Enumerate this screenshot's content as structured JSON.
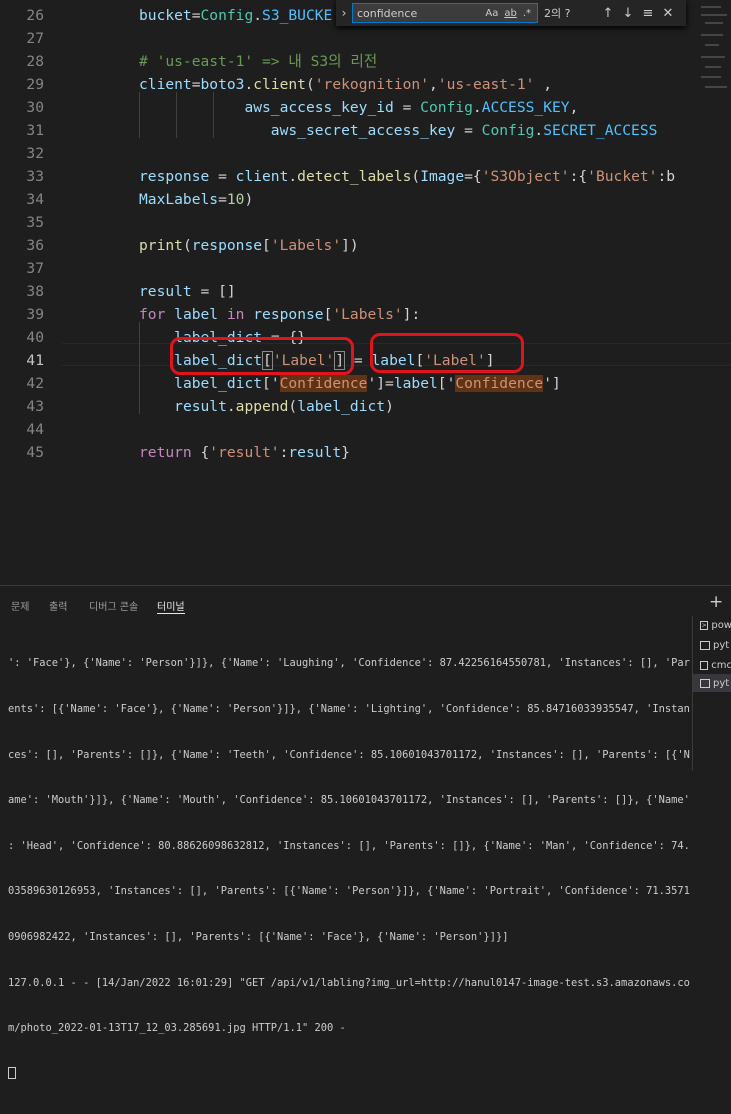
{
  "editor": {
    "lines": [
      {
        "num": "26",
        "tokens": [
          {
            "t": "bucket",
            "c": "v"
          },
          {
            "t": "=",
            "c": "p"
          },
          {
            "t": "Config",
            "c": "cl"
          },
          {
            "t": ".",
            "c": "p"
          },
          {
            "t": "S3_BUCKE",
            "c": "cst"
          }
        ]
      },
      {
        "num": "27",
        "tokens": []
      },
      {
        "num": "28",
        "tokens": [
          {
            "t": "# 'us-east-1' => 내 S3의 리전",
            "c": "c"
          }
        ]
      },
      {
        "num": "29",
        "tokens": [
          {
            "t": "client",
            "c": "v"
          },
          {
            "t": "=",
            "c": "p"
          },
          {
            "t": "boto3",
            "c": "v"
          },
          {
            "t": ".",
            "c": "p"
          },
          {
            "t": "client",
            "c": "f"
          },
          {
            "t": "(",
            "c": "p"
          },
          {
            "t": "'rekognition'",
            "c": "s"
          },
          {
            "t": ",",
            "c": "p"
          },
          {
            "t": "'us-east-1'",
            "c": "s"
          },
          {
            "t": " ,",
            "c": "p"
          }
        ]
      },
      {
        "num": "30",
        "tokens": [
          {
            "t": "            ",
            "c": "p"
          },
          {
            "t": "aws_access_key_id",
            "c": "v"
          },
          {
            "t": " = ",
            "c": "p"
          },
          {
            "t": "Config",
            "c": "cl"
          },
          {
            "t": ".",
            "c": "p"
          },
          {
            "t": "ACCESS_KEY",
            "c": "cst"
          },
          {
            "t": ",",
            "c": "p"
          }
        ]
      },
      {
        "num": "31",
        "tokens": [
          {
            "t": "               ",
            "c": "p"
          },
          {
            "t": "aws_secret_access_key",
            "c": "v"
          },
          {
            "t": " = ",
            "c": "p"
          },
          {
            "t": "Config",
            "c": "cl"
          },
          {
            "t": ".",
            "c": "p"
          },
          {
            "t": "SECRET_ACCESS",
            "c": "cst"
          }
        ]
      },
      {
        "num": "32",
        "tokens": []
      },
      {
        "num": "33",
        "tokens": [
          {
            "t": "response",
            "c": "v"
          },
          {
            "t": " = ",
            "c": "p"
          },
          {
            "t": "client",
            "c": "v"
          },
          {
            "t": ".",
            "c": "p"
          },
          {
            "t": "detect_labels",
            "c": "f"
          },
          {
            "t": "(",
            "c": "p"
          },
          {
            "t": "Image",
            "c": "v"
          },
          {
            "t": "={",
            "c": "p"
          },
          {
            "t": "'S3Object'",
            "c": "s"
          },
          {
            "t": ":{",
            "c": "p"
          },
          {
            "t": "'Bucket'",
            "c": "s"
          },
          {
            "t": ":b",
            "c": "p"
          }
        ]
      },
      {
        "num": "34",
        "tokens": [
          {
            "t": "MaxLabels",
            "c": "v"
          },
          {
            "t": "=",
            "c": "p"
          },
          {
            "t": "10",
            "c": "n"
          },
          {
            "t": ")",
            "c": "p"
          }
        ]
      },
      {
        "num": "35",
        "tokens": []
      },
      {
        "num": "36",
        "tokens": [
          {
            "t": "print",
            "c": "f"
          },
          {
            "t": "(",
            "c": "p"
          },
          {
            "t": "response",
            "c": "v"
          },
          {
            "t": "[",
            "c": "p"
          },
          {
            "t": "'Labels'",
            "c": "s"
          },
          {
            "t": "])",
            "c": "p"
          }
        ]
      },
      {
        "num": "37",
        "tokens": []
      },
      {
        "num": "38",
        "tokens": [
          {
            "t": "result",
            "c": "v"
          },
          {
            "t": " = []",
            "c": "p"
          }
        ]
      },
      {
        "num": "39",
        "tokens": [
          {
            "t": "for",
            "c": "k"
          },
          {
            "t": " ",
            "c": "p"
          },
          {
            "t": "label",
            "c": "v"
          },
          {
            "t": " ",
            "c": "p"
          },
          {
            "t": "in",
            "c": "k"
          },
          {
            "t": " ",
            "c": "p"
          },
          {
            "t": "response",
            "c": "v"
          },
          {
            "t": "[",
            "c": "p"
          },
          {
            "t": "'Labels'",
            "c": "s"
          },
          {
            "t": "]:",
            "c": "p"
          }
        ]
      },
      {
        "num": "40",
        "tokens": [
          {
            "t": "    ",
            "c": "p"
          },
          {
            "t": "label_dict",
            "c": "v"
          },
          {
            "t": " = {}",
            "c": "p"
          }
        ]
      },
      {
        "num": "41",
        "tokens": [
          {
            "t": "    ",
            "c": "p"
          },
          {
            "t": "label_dict",
            "c": "v"
          },
          {
            "t": "[",
            "c": "p",
            "b": 1
          },
          {
            "t": "'Label'",
            "c": "s"
          },
          {
            "t": "]",
            "c": "p",
            "b": 1
          },
          {
            "t": " = ",
            "c": "p"
          },
          {
            "t": "label",
            "c": "v"
          },
          {
            "t": "[",
            "c": "p"
          },
          {
            "t": "'Label'",
            "c": "s"
          },
          {
            "t": "]",
            "c": "p"
          }
        ]
      },
      {
        "num": "42",
        "tokens": [
          {
            "t": "    ",
            "c": "p"
          },
          {
            "t": "label_dict",
            "c": "v"
          },
          {
            "t": "['",
            "c": "p"
          },
          {
            "t": "Confidence",
            "c": "s",
            "h": 1
          },
          {
            "t": "']=",
            "c": "p"
          },
          {
            "t": "label",
            "c": "v"
          },
          {
            "t": "['",
            "c": "p"
          },
          {
            "t": "Confidence",
            "c": "s",
            "h": 1
          },
          {
            "t": "']",
            "c": "p"
          }
        ]
      },
      {
        "num": "43",
        "tokens": [
          {
            "t": "    ",
            "c": "p"
          },
          {
            "t": "result",
            "c": "v"
          },
          {
            "t": ".",
            "c": "p"
          },
          {
            "t": "append",
            "c": "f"
          },
          {
            "t": "(",
            "c": "p"
          },
          {
            "t": "label_dict",
            "c": "v"
          },
          {
            "t": ")",
            "c": "p"
          }
        ]
      },
      {
        "num": "44",
        "tokens": []
      },
      {
        "num": "45",
        "tokens": [
          {
            "t": "return",
            "c": "k"
          },
          {
            "t": " {",
            "c": "p"
          },
          {
            "t": "'result'",
            "c": "s"
          },
          {
            "t": ":",
            "c": "p"
          },
          {
            "t": "result",
            "c": "v"
          },
          {
            "t": "}",
            "c": "p"
          }
        ]
      }
    ]
  },
  "find_widget": {
    "toggle_icon": "chevron-right-icon",
    "value": "confidence",
    "match_case": "Aa",
    "whole_word": "ab",
    "regex": ".*",
    "count": "2의 ?",
    "prev_icon": "↑",
    "next_icon": "↓",
    "selection_icon": "≡",
    "close_icon": "✕"
  },
  "panel": {
    "tabs": [
      "문제",
      "출력",
      "디버그 콘솔",
      "터미널"
    ],
    "active_tab": "터미널",
    "add_label": "+",
    "terminal_lines": [
      "': 'Face'}, {'Name': 'Person'}]}, {'Name': 'Laughing', 'Confidence': 87.42256164550781, 'Instances': [], 'Par",
      "ents': [{'Name': 'Face'}, {'Name': 'Person'}]}, {'Name': 'Lighting', 'Confidence': 85.84716033935547, 'Instan",
      "ces': [], 'Parents': []}, {'Name': 'Teeth', 'Confidence': 85.10601043701172, 'Instances': [], 'Parents': [{'N",
      "ame': 'Mouth'}]}, {'Name': 'Mouth', 'Confidence': 85.10601043701172, 'Instances': [], 'Parents': []}, {'Name'",
      ": 'Head', 'Confidence': 80.88626098632812, 'Instances': [], 'Parents': []}, {'Name': 'Man', 'Confidence': 74.",
      "03589630126953, 'Instances': [], 'Parents': [{'Name': 'Person'}]}, {'Name': 'Portrait', 'Confidence': 71.3571",
      "0906982422, 'Instances': [], 'Parents': [{'Name': 'Face'}, {'Name': 'Person'}]}]",
      "127.0.0.1 - - [14/Jan/2022 16:01:29] \"GET /api/v1/labling?img_url=http://hanul0147-image-test.s3.amazonaws.co",
      "m/photo_2022-01-13T17_12_03.285691.jpg HTTP/1.1\" 200 -"
    ],
    "sessions": [
      {
        "icon": "terminal-icon",
        "label": "pow"
      },
      {
        "icon": "terminal-icon",
        "label": "pyt"
      },
      {
        "icon": "terminal-icon",
        "label": "cmc"
      },
      {
        "icon": "terminal-icon",
        "label": "pyt"
      }
    ]
  },
  "colors": {
    "annotation": "#e0141c",
    "find_highlight": "#613214",
    "background": "#1e1e1e"
  }
}
